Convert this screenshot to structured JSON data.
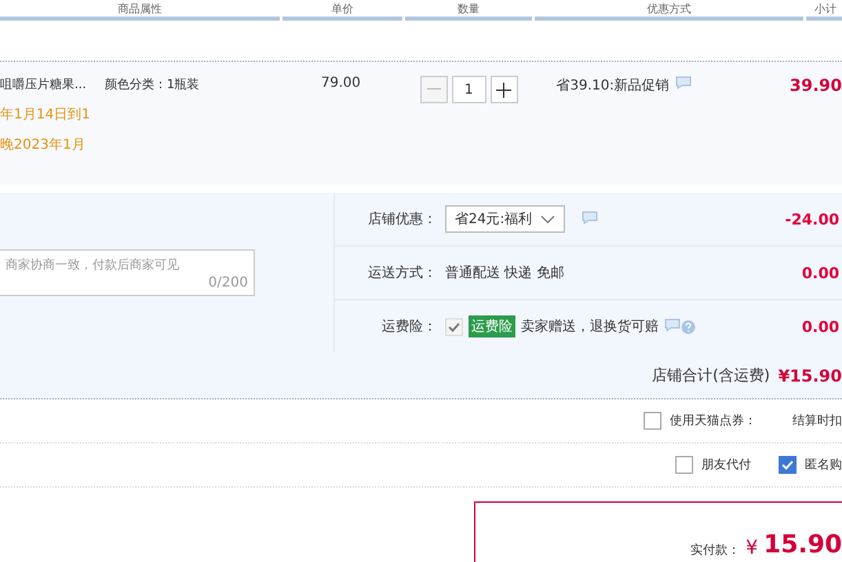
{
  "columns": [
    {
      "label": "商品属性"
    },
    {
      "label": "单价"
    },
    {
      "label": "数量"
    },
    {
      "label": "优惠方式"
    },
    {
      "label": "小计"
    }
  ],
  "item": {
    "name": "咀嚼压片糖果...",
    "attribute": "颜色分类：1瓶装",
    "price": "79.00",
    "quantity": "1",
    "minus_disabled": true,
    "promo": "省39.10:新品促销",
    "subtotal": "39.90",
    "notes": [
      "年1月14日到1",
      "晚2023年1月"
    ]
  },
  "message": {
    "placeholder": "商家协商一致，付款后商家可见",
    "counter": "0/200"
  },
  "options": [
    {
      "kind": "select",
      "label": "店铺优惠：",
      "value": "省24元:福利",
      "amount": "-24.00"
    },
    {
      "kind": "text",
      "label": "运送方式：",
      "value": "普通配送 快递 免邮",
      "amount": "0.00"
    },
    {
      "kind": "insurance",
      "label": "运费险：",
      "checked": true,
      "disabled": true,
      "badge": "运费险",
      "value": "卖家赠送，退换货可赔",
      "amount": "0.00"
    }
  ],
  "store_total": {
    "label": "店铺合计(含运费)",
    "value": "¥15.90"
  },
  "coupon": {
    "label": "使用天猫点券：",
    "checked": false,
    "note": "结算时扣"
  },
  "extras": [
    {
      "label": "朋友代付",
      "checked": false
    },
    {
      "label": "匿名购",
      "checked": true
    }
  ],
  "payment": {
    "label": "实付款：",
    "currency": "¥",
    "value": "15.90"
  }
}
